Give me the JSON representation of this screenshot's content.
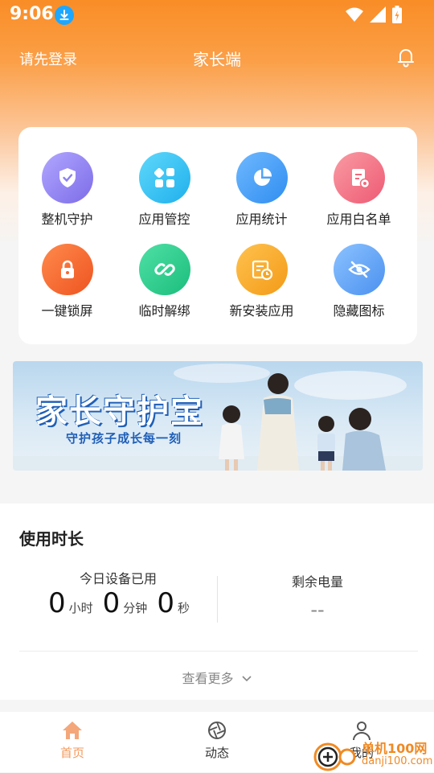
{
  "status_bar": {
    "time": "9:06"
  },
  "header": {
    "login": "请先登录",
    "title": "家长端"
  },
  "features": [
    {
      "label": "整机守护",
      "icon": "shield-icon",
      "color": "#8d80f0"
    },
    {
      "label": "应用管控",
      "icon": "apps-icon",
      "color": "#33c2f0"
    },
    {
      "label": "应用统计",
      "icon": "pie-chart-icon",
      "color": "#3fa0f5"
    },
    {
      "label": "应用白名单",
      "icon": "document-settings-icon",
      "color": "#f06a7c"
    },
    {
      "label": "一键锁屏",
      "icon": "lock-icon",
      "color": "#f5682e"
    },
    {
      "label": "临时解绑",
      "icon": "link-icon",
      "color": "#2bcf90"
    },
    {
      "label": "新安装应用",
      "icon": "install-clock-icon",
      "color": "#f5a623"
    },
    {
      "label": "隐藏图标",
      "icon": "eye-off-icon",
      "color": "#4e9cf5"
    }
  ],
  "banner": {
    "title": "家长守护宝",
    "subtitle": "守护孩子成长每一刻"
  },
  "usage": {
    "title": "使用时长",
    "today_label": "今日设备已用",
    "hours": "0",
    "hours_unit": "小时",
    "minutes": "0",
    "minutes_unit": "分钟",
    "seconds": "0",
    "seconds_unit": "秒",
    "battery_label": "剩余电量",
    "battery_value": "--",
    "more": "查看更多"
  },
  "tabbar": {
    "home": "首页",
    "feed": "动态",
    "mine": "我的"
  },
  "watermark": {
    "name": "单机100网",
    "url": "danji100.com"
  }
}
